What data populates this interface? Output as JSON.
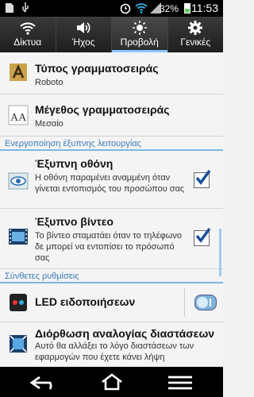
{
  "status": {
    "battery": "32%",
    "time": "11:53"
  },
  "tabs": [
    {
      "label": "Δίκτυα",
      "icon": "wifi-icon"
    },
    {
      "label": "Ήχος",
      "icon": "speaker-icon"
    },
    {
      "label": "Προβολή",
      "icon": "brightness-icon"
    },
    {
      "label": "Γενικές",
      "icon": "gear-icon"
    }
  ],
  "active_tab": "Προβολή",
  "rows": {
    "font_type": {
      "title": "Τύπος γραμματοσειράς",
      "value": "Roboto",
      "icon": "font-type-icon"
    },
    "font_size": {
      "title": "Μέγεθος γραμματοσειράς",
      "value": "Μεσαίο",
      "icon": "font-size-icon"
    },
    "smart_screen": {
      "title": "Έξυπνη οθόνη",
      "desc": "Η οθόνη παραμένει αναμμένη όταν γίνεται εντοπισμός του προσώπου σας",
      "checked": true,
      "icon": "eye-icon"
    },
    "smart_video": {
      "title": "Έξυπνο βίντεο",
      "desc": "Το βίντεο σταματάει όταν το τηλέφωνο δε μπορεί να εντοπίσει το πρόσωπό σας",
      "checked": true,
      "icon": "film-icon"
    },
    "led": {
      "title": "LED ειδοποιήσεων",
      "toggle": "on",
      "icon": "led-icon"
    },
    "aspect": {
      "title": "Διόρθωση αναλογίας διαστάσεων",
      "desc": "Αυτό θα αλλάξει το λόγο διαστάσεων των εφαρμογών που έχετε κάνει λήψη",
      "icon": "aspect-icon"
    }
  },
  "sections": {
    "smart": "Ενεργοποίηση έξυπνης λειτουργίας",
    "advanced": "Σύνθετες ρυθμίσεις"
  },
  "nav": [
    {
      "icon": "back-icon"
    },
    {
      "icon": "home-icon"
    },
    {
      "icon": "menu-icon"
    }
  ],
  "colors": {
    "accent": "#7db7e0",
    "section_text": "#3a7ab8"
  }
}
